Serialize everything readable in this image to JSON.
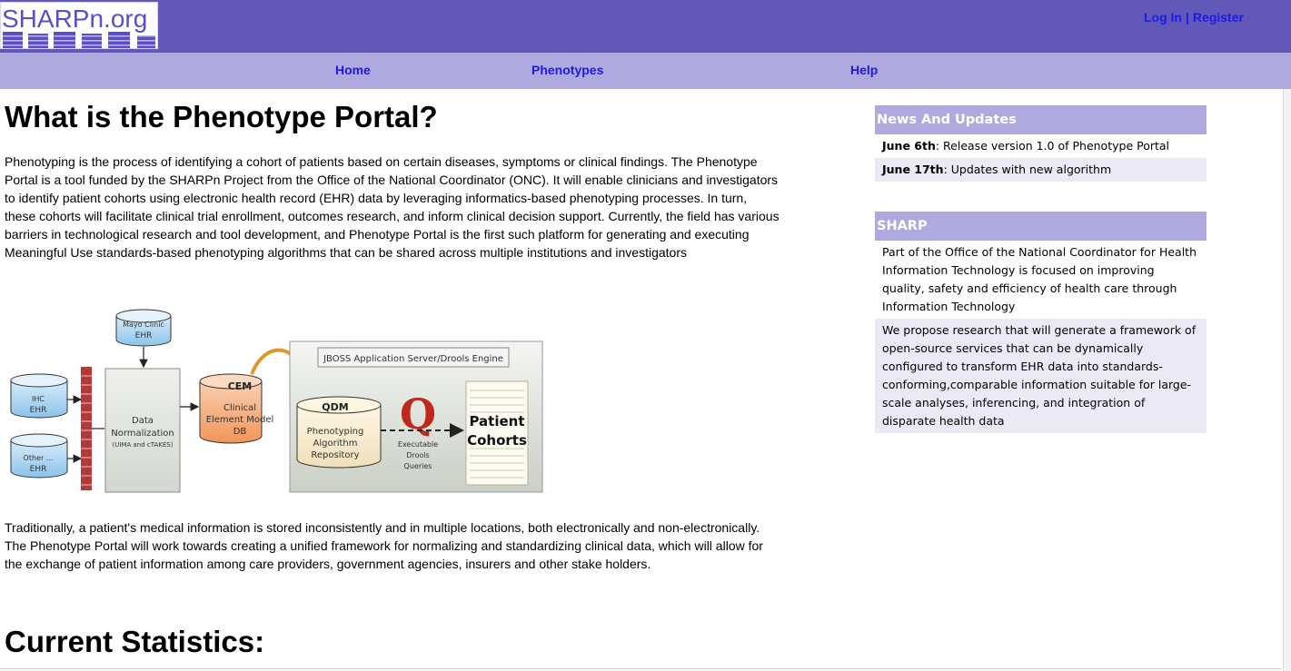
{
  "logo": {
    "text": "SHARPn.org"
  },
  "auth": {
    "login": "Log In",
    "separator": "|",
    "register": "Register"
  },
  "nav": {
    "home": "Home",
    "phenotypes": "Phenotypes",
    "help": "Help"
  },
  "main": {
    "title": "What is the Phenotype Portal?",
    "intro": "Phenotyping is the process of identifying a cohort of patients based on certain diseases, symptoms or clinical findings. The Phenotype Portal is a tool funded by the SHARPn Project from the Office of the National Coordinator (ONC). It will enable clinicians and investigators to identify patient cohorts using electronic health record (EHR) data by leveraging informatics-based phenotyping processes. In turn, these cohorts will facilitate clinical trial enrollment, outcomes research, and inform clinical decision support. Currently, the field has various barriers in technological research and tool development, and Phenotype Portal is the first such platform for generating and executing Meaningful Use standards-based phenotyping algorithms that can be shared across multiple institutions and investigators",
    "paragraph2": "Traditionally, a patient's medical information is stored inconsistently and in multiple locations, both electronically and non-electronically. The Phenotype Portal will work towards creating a unified framework for normalizing and standardizing clinical data, which will allow for the exchange of patient information among care providers, government agencies, insurers and other stake holders.",
    "stats_title": "Current Statistics:"
  },
  "diagram": {
    "mayo": [
      "Mayo Clinic",
      "EHR"
    ],
    "ihc": [
      "IHC",
      "EHR"
    ],
    "other": [
      "Other ...",
      "EHR"
    ],
    "normalization": [
      "Data",
      "Normalization",
      "(UIMA and cTAKES)"
    ],
    "cem_label": "CEM",
    "cem_db": [
      "Clinical",
      "Element Model",
      "DB"
    ],
    "jboss": "JBOSS Application Server/Drools Engine",
    "qdm_label": "QDM",
    "qdm_repo": [
      "Phenotyping",
      "Algorithm",
      "Repository"
    ],
    "queries": [
      "Executable",
      "Drools",
      "Queries"
    ],
    "cohorts": [
      "Patient",
      "Cohorts"
    ],
    "q_letter": "Q"
  },
  "news": {
    "header": "News And Updates",
    "items": [
      {
        "date": "June 6th",
        "text": ": Release version 1.0 of Phenotype Portal"
      },
      {
        "date": "June 17th",
        "text": ": Updates with new algorithm"
      }
    ]
  },
  "sharp": {
    "header": "SHARP",
    "items": [
      "Part of the Office of the National Coordinator for Health Information Technology is focused on improving quality, safety and efficiency of health care through Information Technology",
      "We propose research that will generate a framework of open-source services that can be dynamically configured to transform EHR data into standards-conforming,comparable information suitable for large-scale analyses, inferencing, and integration of disparate health data"
    ]
  },
  "colors": {
    "topbar": "#6158b8",
    "navbar": "#aea9de",
    "link": "#1a1aee",
    "side_header": "#aea9de",
    "side_alt_row": "#ebe9f6"
  }
}
